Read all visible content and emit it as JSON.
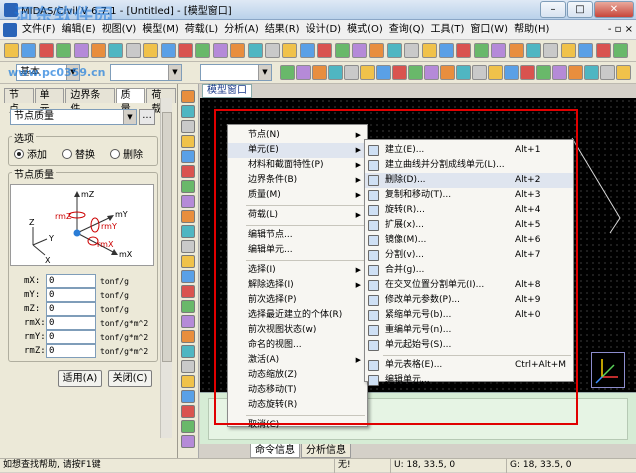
{
  "window": {
    "title": "MIDAS/Civil V 6.7.1 - [Untitled] - [模型窗口]",
    "watermark": "河东软件园",
    "website": "www.pc0359.cn",
    "controls": [
      "–",
      "□",
      "✕"
    ]
  },
  "menu": [
    "文件(F)",
    "编辑(E)",
    "视图(V)",
    "模型(M)",
    "荷载(L)",
    "分析(A)",
    "结果(R)",
    "设计(D)",
    "模式(O)",
    "查询(Q)",
    "工具(T)",
    "窗口(W)",
    "帮助(H)"
  ],
  "toolbar2": {
    "unit_combo": "基本"
  },
  "left_panel": {
    "tabs": [
      "节点",
      "单元",
      "边界条件",
      "质量",
      "荷载"
    ],
    "active_tab": "质量",
    "dropdown": "节点质量",
    "dot_button": "...",
    "options_group": "选项",
    "radios": [
      {
        "label": "添加",
        "checked": true
      },
      {
        "label": "替换",
        "checked": false
      },
      {
        "label": "删除",
        "checked": false
      }
    ],
    "mass_group": "节点质量",
    "diagram_labels": {
      "mz": "mZ",
      "rmz": "rmZ",
      "my": "mY",
      "rmy": "rmY",
      "mx": "mX",
      "rmx": "rmX",
      "z": "Z",
      "y": "Y",
      "x": "X"
    },
    "fields": [
      {
        "label": "mX:",
        "value": "0",
        "unit": "tonf/g"
      },
      {
        "label": "mY:",
        "value": "0",
        "unit": "tonf/g"
      },
      {
        "label": "mZ:",
        "value": "0",
        "unit": "tonf/g"
      },
      {
        "label": "rmX:",
        "value": "0",
        "unit": "tonf/g*m^2"
      },
      {
        "label": "rmY:",
        "value": "0",
        "unit": "tonf/g*m^2"
      },
      {
        "label": "rmZ:",
        "value": "0",
        "unit": "tonf/g*m^2"
      }
    ],
    "apply_button": "适用(A)",
    "close_button": "关闭(C)"
  },
  "model_tab": "模型窗口",
  "context_menu_main": [
    {
      "label": "节点(N)",
      "submenu": true
    },
    {
      "label": "单元(E)",
      "submenu": true,
      "highlight": true
    },
    {
      "label": "材料和截面特性(P)",
      "submenu": true
    },
    {
      "label": "边界条件(B)",
      "submenu": true
    },
    {
      "label": "质量(M)",
      "submenu": true
    },
    {
      "sep": true
    },
    {
      "label": "荷载(L)",
      "submenu": true
    },
    {
      "sep": true
    },
    {
      "label": "编辑节点..."
    },
    {
      "label": "编辑单元..."
    },
    {
      "sep": true
    },
    {
      "label": "选择(I)",
      "submenu": true
    },
    {
      "label": "解除选择(I)",
      "submenu": true
    },
    {
      "label": "前次选择(P)"
    },
    {
      "label": "选择最近建立的个体(R)"
    },
    {
      "label": "前次视图状态(w)"
    },
    {
      "label": "命名的视图..."
    },
    {
      "label": "激活(A)",
      "submenu": true
    },
    {
      "label": "动态缩放(Z)"
    },
    {
      "label": "动态移动(T)"
    },
    {
      "label": "动态旋转(R)"
    },
    {
      "sep": true
    },
    {
      "label": "取消(C)"
    }
  ],
  "context_menu_sub": [
    {
      "label": "建立(E)...",
      "shortcut": "Alt+1"
    },
    {
      "label": "建立曲线并分割成线单元(L)..."
    },
    {
      "label": "删除(D)...",
      "shortcut": "Alt+2",
      "highlight": true
    },
    {
      "label": "复制和移动(T)...",
      "shortcut": "Alt+3"
    },
    {
      "label": "旋转(R)...",
      "shortcut": "Alt+4"
    },
    {
      "label": "扩展(x)...",
      "shortcut": "Alt+5"
    },
    {
      "label": "镜像(M)...",
      "shortcut": "Alt+6"
    },
    {
      "label": "分割(v)...",
      "shortcut": "Alt+7"
    },
    {
      "label": "合并(g)..."
    },
    {
      "label": "在交叉位置分割单元(I)...",
      "shortcut": "Alt+8"
    },
    {
      "label": "修改单元参数(P)...",
      "shortcut": "Alt+9"
    },
    {
      "label": "紧缩单元号(b)...",
      "shortcut": "Alt+0"
    },
    {
      "label": "重编单元号(n)..."
    },
    {
      "label": "单元起始号(S)..."
    },
    {
      "sep": true
    },
    {
      "label": "单元表格(E)...",
      "shortcut": "Ctrl+Alt+M"
    },
    {
      "label": "编辑单元..."
    }
  ],
  "bottom_tabs": [
    "命令信息",
    "分析信息"
  ],
  "status": {
    "help": "如想查找帮助, 请按F1键",
    "selection": "无!",
    "u": "U: 18, 33.5, 0",
    "g": "G: 18, 33.5, 0"
  },
  "colors": {
    "accent_red": "#e00000",
    "highlight": "#dfe5ef"
  }
}
